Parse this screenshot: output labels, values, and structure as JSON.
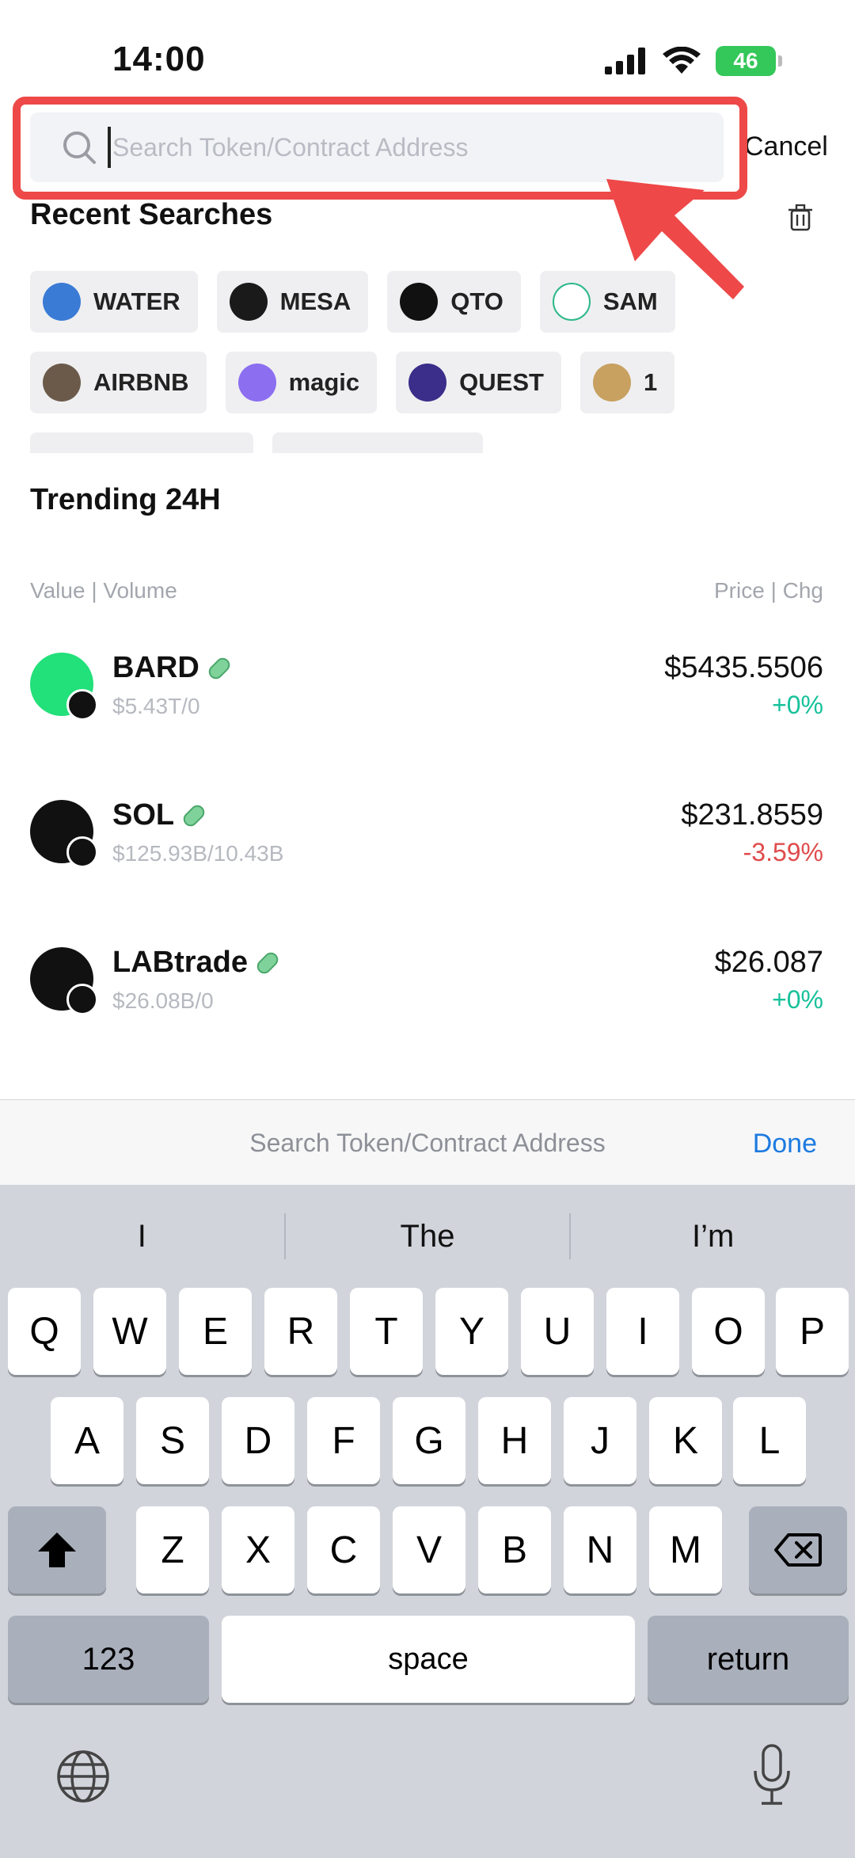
{
  "status": {
    "time": "14:00",
    "battery": "46"
  },
  "search": {
    "placeholder": "Search Token/Contract Address",
    "value": "",
    "cancel_label": "Cancel"
  },
  "recent": {
    "title": "Recent Searches",
    "chips": [
      {
        "label": "WATER",
        "color": "#3a7bd5"
      },
      {
        "label": "MESA",
        "color": "#1a1a1a"
      },
      {
        "label": "QTO",
        "color": "#111111"
      },
      {
        "label": "SAM",
        "color": "#2db88a"
      },
      {
        "label": "AIRBNB",
        "color": "#6b5a4a"
      },
      {
        "label": "magic",
        "color": "#8c6ef0"
      },
      {
        "label": "QUEST",
        "color": "#3b2d8a"
      },
      {
        "label": "1",
        "color": "#c8a060"
      }
    ]
  },
  "trending": {
    "title": "Trending 24H",
    "col_left": "Value | Volume",
    "col_right": "Price | Chg",
    "tokens": [
      {
        "name": "BARD",
        "sub": "$5.43T/0",
        "price": "$5435.5506",
        "chg": "+0%",
        "dir": "up",
        "logo_color": "#22e07a"
      },
      {
        "name": "SOL",
        "sub": "$125.93B/10.43B",
        "price": "$231.8559",
        "chg": "-3.59%",
        "dir": "down",
        "logo_color": "#111111"
      },
      {
        "name": "LABtrade",
        "sub": "$26.08B/0",
        "price": "$26.087",
        "chg": "+0%",
        "dir": "up",
        "logo_color": "#111111"
      }
    ]
  },
  "keyboard": {
    "accessory_text": "Search Token/Contract Address",
    "done_label": "Done",
    "suggestions": [
      "I",
      "The",
      "I’m"
    ],
    "row1": [
      "Q",
      "W",
      "E",
      "R",
      "T",
      "Y",
      "U",
      "I",
      "O",
      "P"
    ],
    "row2": [
      "A",
      "S",
      "D",
      "F",
      "G",
      "H",
      "J",
      "K",
      "L"
    ],
    "row3": [
      "Z",
      "X",
      "C",
      "V",
      "B",
      "N",
      "M"
    ],
    "numbers_label": "123",
    "space_label": "space",
    "return_label": "return"
  }
}
